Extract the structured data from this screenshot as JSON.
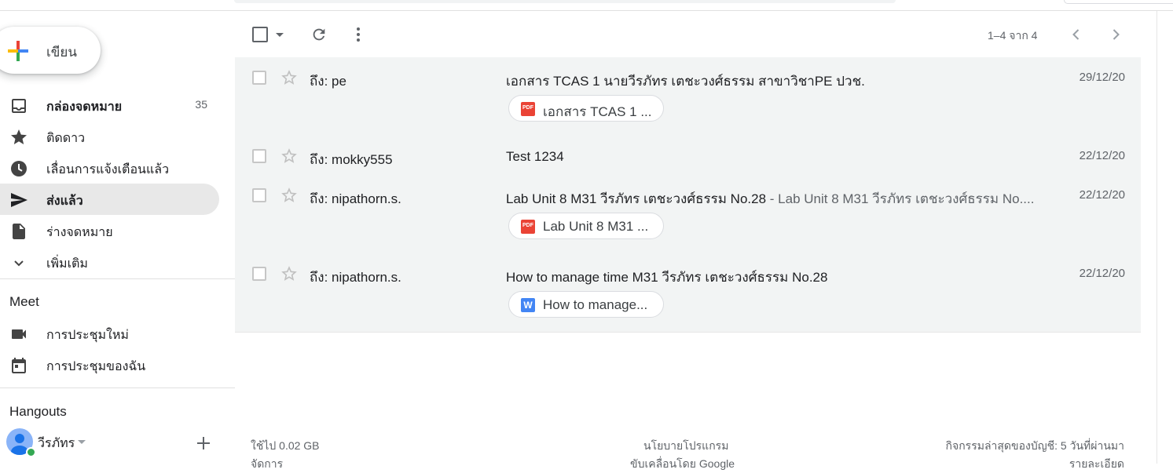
{
  "compose": {
    "label": "เขียน"
  },
  "sidebar": {
    "items": [
      {
        "label": "กล่องจดหมาย",
        "count": "35",
        "icon": "inbox-icon"
      },
      {
        "label": "ติดดาว",
        "icon": "star-icon"
      },
      {
        "label": "เลื่อนการแจ้งเตือนแล้ว",
        "icon": "clock-icon"
      },
      {
        "label": "ส่งแล้ว",
        "icon": "send-icon"
      },
      {
        "label": "ร่างจดหมาย",
        "icon": "draft-icon"
      },
      {
        "label": "เพิ่มเติม",
        "icon": "chevron-down-icon"
      }
    ],
    "meet": {
      "title": "Meet",
      "items": [
        {
          "label": "การประชุมใหม่",
          "icon": "video-camera-icon"
        },
        {
          "label": "การประชุมของฉัน",
          "icon": "calendar-icon"
        }
      ]
    },
    "hangouts": {
      "title": "Hangouts",
      "user": "วีรภัทร"
    }
  },
  "toolbar": {
    "pager": "1–4 จาก 4"
  },
  "mails": [
    {
      "sender": "ถึง: pe",
      "subject": "เอกสาร TCAS 1 นายวีรภัทร เตชะวงศ์ธรรม สาขาวิชาPE ปวช.",
      "snippet": "",
      "date": "29/12/20",
      "attachment": {
        "type": "pdf",
        "badge": "PDF",
        "name": "เอกสาร TCAS 1 ..."
      }
    },
    {
      "sender": "ถึง: mokky555",
      "subject": "Test 1234",
      "snippet": "",
      "date": "22/12/20"
    },
    {
      "sender": "ถึง: nipathorn.s.",
      "subject": "Lab Unit 8 M31 วีรภัทร เตชะวงศ์ธรรม No.28",
      "snippet": " - Lab Unit 8 M31 วีรภัทร เตชะวงศ์ธรรม No....",
      "date": "22/12/20",
      "attachment": {
        "type": "pdf",
        "badge": "PDF",
        "name": "Lab Unit 8 M31 ..."
      }
    },
    {
      "sender": "ถึง: nipathorn.s.",
      "subject": "How to manage time M31 วีรภัทร เตชะวงศ์ธรรม No.28",
      "snippet": "",
      "date": "22/12/20",
      "attachment": {
        "type": "word",
        "badge": "W",
        "name": "How to manage..."
      }
    }
  ],
  "footer": {
    "storage": "ใช้ไป 0.02 GB",
    "manage": "จัดการ",
    "policy": "นโยบายโปรแกรม",
    "powered": "ขับเคลื่อนโดย Google",
    "activity": "กิจกรรมล่าสุดของบัญชี: 5 วันที่ผ่านมา",
    "details": "รายละเอียด"
  }
}
